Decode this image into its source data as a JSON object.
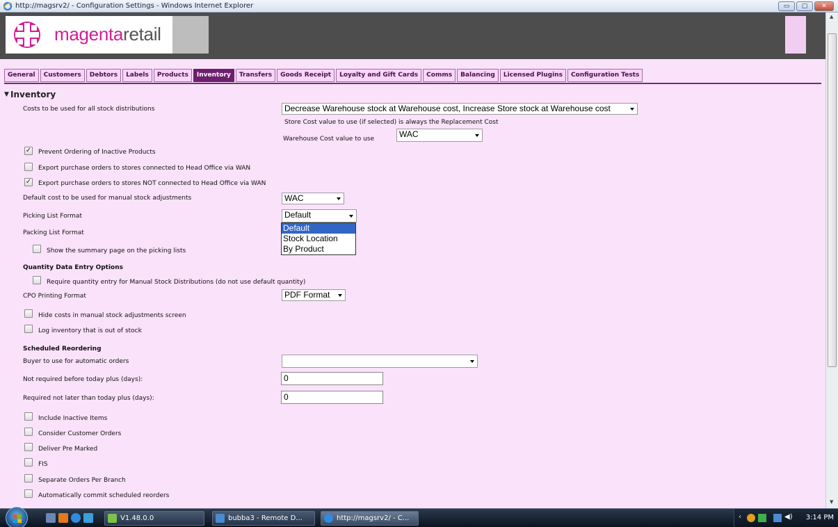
{
  "window": {
    "title": "http://magsrv2/ - Configuration Settings - Windows Internet Explorer",
    "minimize_glyph": "▭",
    "maximize_glyph": "▢",
    "close_glyph": "✕"
  },
  "brand": {
    "name_highlight": "magenta",
    "name_rest": "retail"
  },
  "tabs": [
    {
      "label": "General"
    },
    {
      "label": "Customers"
    },
    {
      "label": "Debtors"
    },
    {
      "label": "Labels"
    },
    {
      "label": "Products"
    },
    {
      "label": "Inventory"
    },
    {
      "label": "Transfers"
    },
    {
      "label": "Goods Receipt"
    },
    {
      "label": "Loyalty and Gift Cards"
    },
    {
      "label": "Comms"
    },
    {
      "label": "Balancing"
    },
    {
      "label": "Licensed Plugins"
    },
    {
      "label": "Configuration Tests"
    }
  ],
  "active_tab": "Inventory",
  "inventory": {
    "section_title": "Inventory",
    "costs_label": "Costs to be used for all stock distributions",
    "costs_value": "Decrease Warehouse stock at Warehouse cost, Increase Store stock at Warehouse cost",
    "store_cost_note": "Store Cost value to use (if selected) is always the Replacement Cost",
    "warehouse_cost_label": "Warehouse Cost value to use",
    "warehouse_cost_value": "WAC",
    "prevent_ordering_label": "Prevent Ordering of Inactive Products",
    "prevent_ordering_checked": true,
    "export_wan_label": "Export purchase orders to stores connected to Head Office via WAN",
    "export_wan_checked": false,
    "export_not_wan_label": "Export purchase orders to stores NOT connected to Head Office via WAN",
    "export_not_wan_checked": true,
    "default_cost_label": "Default cost to be used for manual stock adjustments",
    "default_cost_value": "WAC",
    "picking_list_label": "Picking List Format",
    "picking_list_value": "Default",
    "picking_list_options": [
      "Default",
      "Stock Location",
      "By Product"
    ],
    "packing_list_label": "Packing List Format",
    "show_summary_label": "Show the summary page on the picking lists",
    "quantity_heading": "Quantity Data Entry Options",
    "require_quantity_label": "Require quantity entry for Manual Stock Distributions (do not use default quantity)",
    "cpo_label": "CPO Printing Format",
    "cpo_value": "PDF Format",
    "hide_costs_label": "Hide costs in manual stock adjustments screen",
    "log_inventory_label": "Log inventory that is out of stock",
    "reorder_heading": "Scheduled Reordering",
    "buyer_label": "Buyer to use for automatic orders",
    "buyer_value": "",
    "not_required_label": "Not required before today plus (days):",
    "not_required_value": "0",
    "required_label": "Required not later than today plus (days):",
    "required_value": "0",
    "include_inactive_label": "Include Inactive Items",
    "consider_customer_label": "Consider Customer Orders",
    "deliver_pre_marked_label": "Deliver Pre Marked",
    "fis_label": "FIS",
    "separate_orders_label": "Separate Orders Per Branch",
    "auto_commit_label": "Automatically commit scheduled reorders"
  },
  "taskbar": {
    "items": [
      {
        "label": "V1.48.0.0"
      },
      {
        "label": "bubba3 - Remote D..."
      },
      {
        "label": "http://magsrv2/ - C..."
      }
    ],
    "clock": "3:14 PM"
  }
}
